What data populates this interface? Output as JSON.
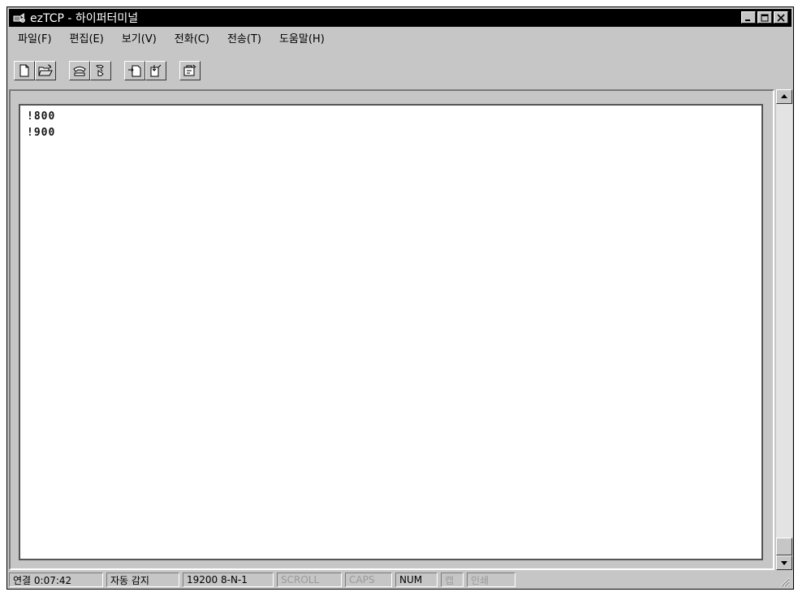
{
  "window": {
    "title": "ezTCP - 하이퍼터미널",
    "app_icon": "hyperterminal-icon",
    "controls": [
      "minimize-icon",
      "maximize-icon",
      "close-icon"
    ]
  },
  "menubar": {
    "items": [
      {
        "label": "파일(F)"
      },
      {
        "label": "편집(E)"
      },
      {
        "label": "보기(V)"
      },
      {
        "label": "전화(C)"
      },
      {
        "label": "전송(T)"
      },
      {
        "label": "도움말(H)"
      }
    ]
  },
  "toolbar": {
    "buttons": [
      {
        "icon": "new-document-icon"
      },
      {
        "icon": "open-folder-icon"
      },
      {
        "icon": "dial-phone-icon"
      },
      {
        "icon": "disconnect-icon"
      },
      {
        "icon": "send-file-icon"
      },
      {
        "icon": "receive-file-icon"
      },
      {
        "icon": "properties-icon"
      }
    ]
  },
  "terminal": {
    "lines": [
      "!800",
      "!900"
    ]
  },
  "statusbar": {
    "connection": "연결 0:07:42",
    "detect": "자동 감지",
    "settings": "19200 8-N-1",
    "scroll": "SCROLL",
    "caps": "CAPS",
    "num": "NUM",
    "capture": "캡",
    "print_echo": "인쇄"
  },
  "colors": {
    "chrome": "#c6c6c6",
    "titlebar": "#000000",
    "terminal_bg": "#ffffff"
  }
}
